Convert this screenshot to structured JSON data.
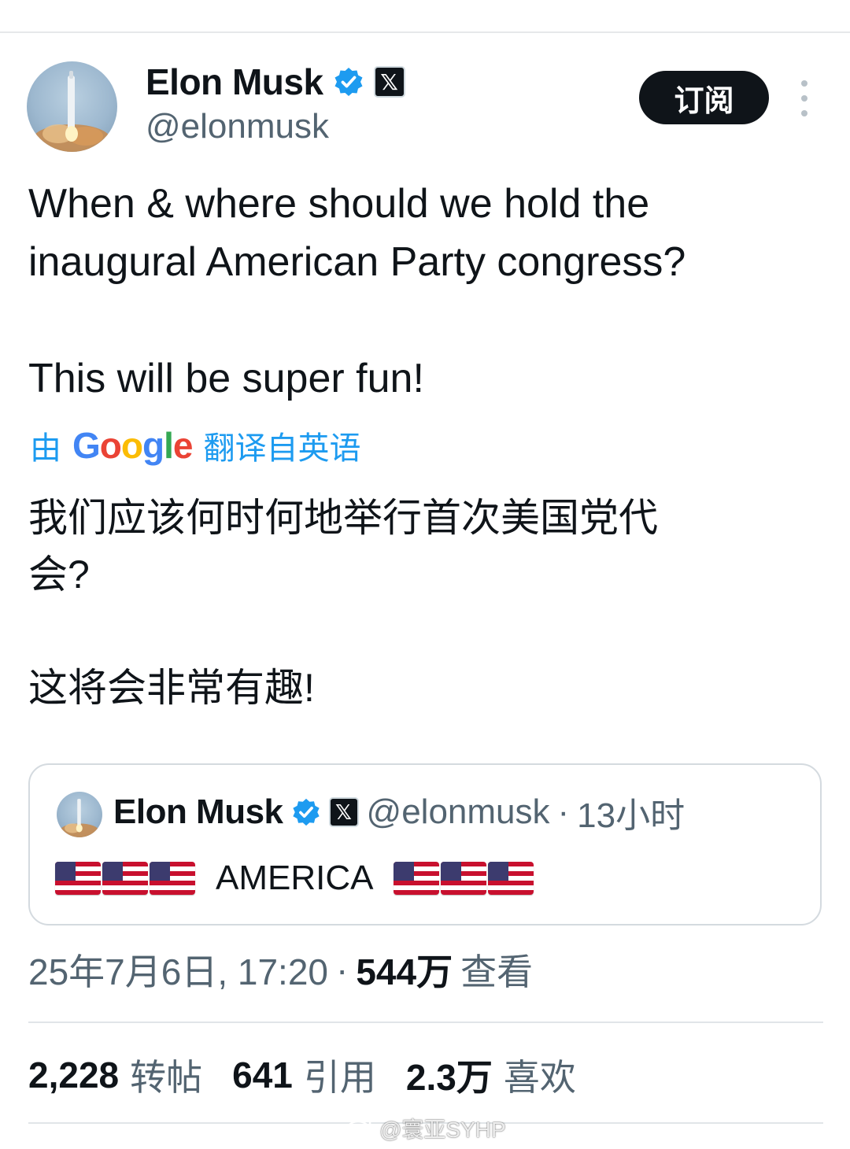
{
  "tweet": {
    "author_name": "Elon Musk",
    "handle": "@elonmusk",
    "subscribe_label": "订阅",
    "text_line1": "When & where should we hold the",
    "text_line2": "inaugural American Party congress?",
    "text_line3": "This will be super fun!",
    "translate_prefix": "由",
    "translate_brand": "Google",
    "translate_suffix": "翻译自英语",
    "translated_line1": "我们应该何时何地举行首次美国党代",
    "translated_line2": "会?",
    "translated_line3": "这将会非常有趣!"
  },
  "quote": {
    "author_name": "Elon Musk",
    "handle": "@elonmusk",
    "separator": "·",
    "time": "13小时",
    "text": "AMERICA",
    "flags_left": [
      "🇺🇸",
      "🇺🇸",
      "🇺🇸"
    ],
    "flags_right": [
      "🇺🇸",
      "🇺🇸",
      "🇺🇸"
    ]
  },
  "meta": {
    "timestamp": "25年7月6日, 17:20",
    "separator": "·",
    "views_count": "544万",
    "views_label": "查看"
  },
  "stats": {
    "reposts_count": "2,228",
    "reposts_label": "转帖",
    "quotes_count": "641",
    "quotes_label": "引用",
    "likes_count": "2.3万",
    "likes_label": "喜欢"
  },
  "watermark": {
    "text": "@寰亚SYHP"
  },
  "colors": {
    "accent": "#1d9bf0",
    "text_primary": "#0f1419",
    "text_secondary": "#536471",
    "divider": "#e1e5e8",
    "button_bg": "#0f1419"
  },
  "icons": [
    "verified-icon",
    "x-logo-icon",
    "more-icon",
    "us-flag-icon",
    "weibo-icon"
  ]
}
